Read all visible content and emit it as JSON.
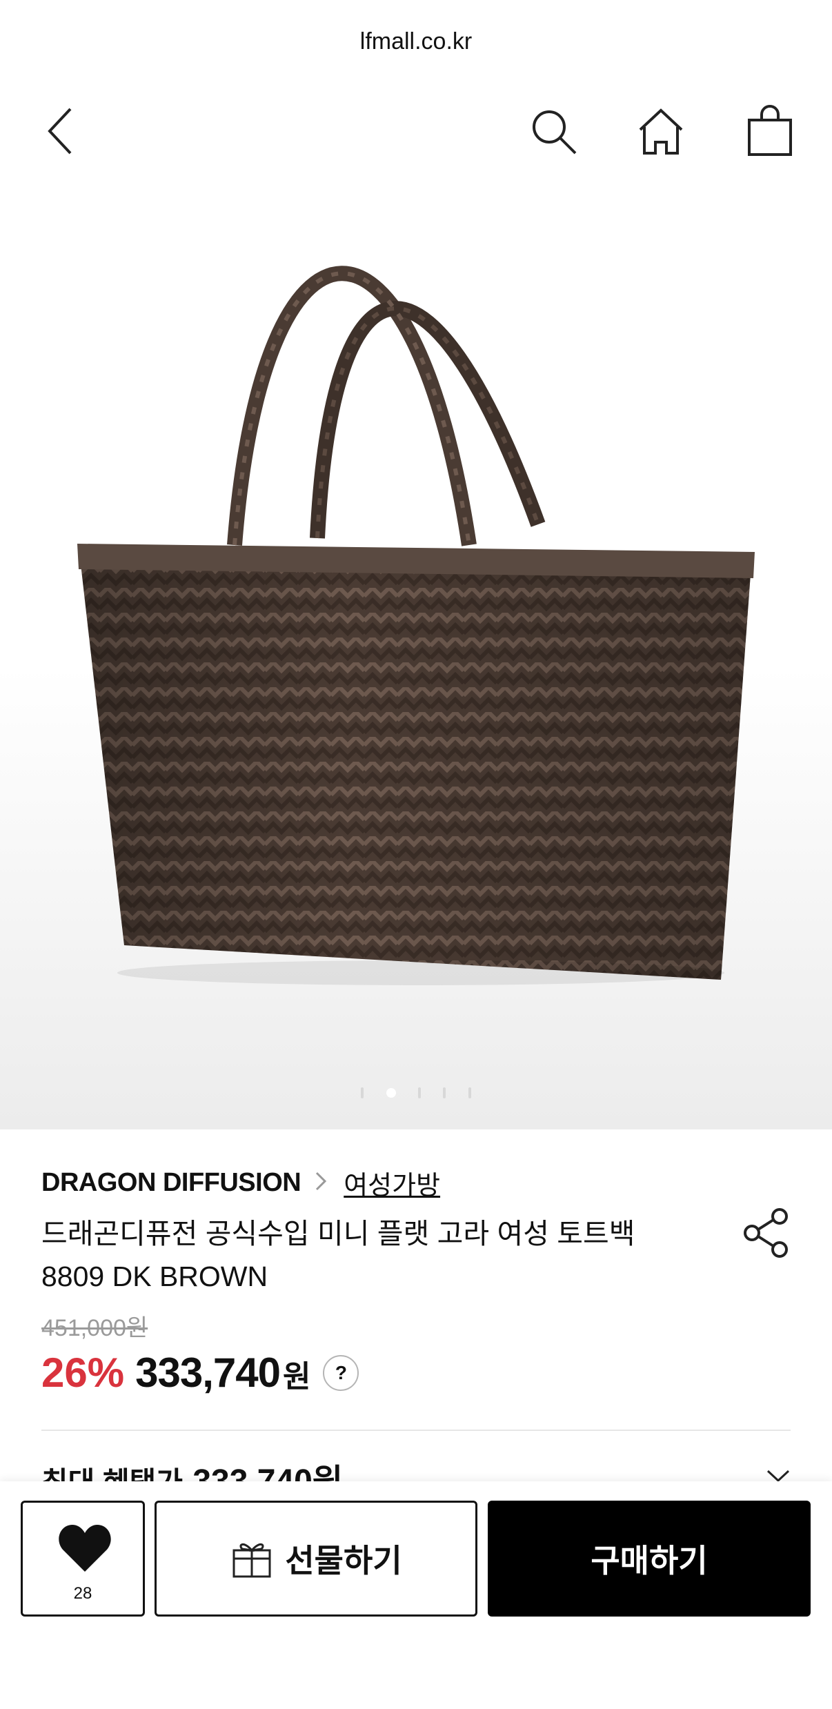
{
  "browser": {
    "url": "lfmall.co.kr"
  },
  "nav": {
    "back_icon": "chevron-left-icon",
    "search_icon": "search-icon",
    "home_icon": "home-icon",
    "cart_icon": "shopping-bag-icon"
  },
  "gallery": {
    "image_count": 5,
    "active_index": 1
  },
  "product": {
    "brand": "DRAGON DIFFUSION",
    "category": "여성가방",
    "title_line1": "드래곤디퓨전 공식수입 미니 플랫 고라 여성 토트백",
    "title_line2": "8809 DK BROWN",
    "original_price": "451,000원",
    "discount": "26%",
    "price": "333,740",
    "currency": "원",
    "help": "?",
    "benefit_label": "최대 혜택가",
    "benefit_price": "333,740원"
  },
  "actions": {
    "like_count": "28",
    "gift_label": "선물하기",
    "buy_label": "구매하기"
  },
  "colors": {
    "discount": "#d9333d",
    "primary": "#000000"
  }
}
